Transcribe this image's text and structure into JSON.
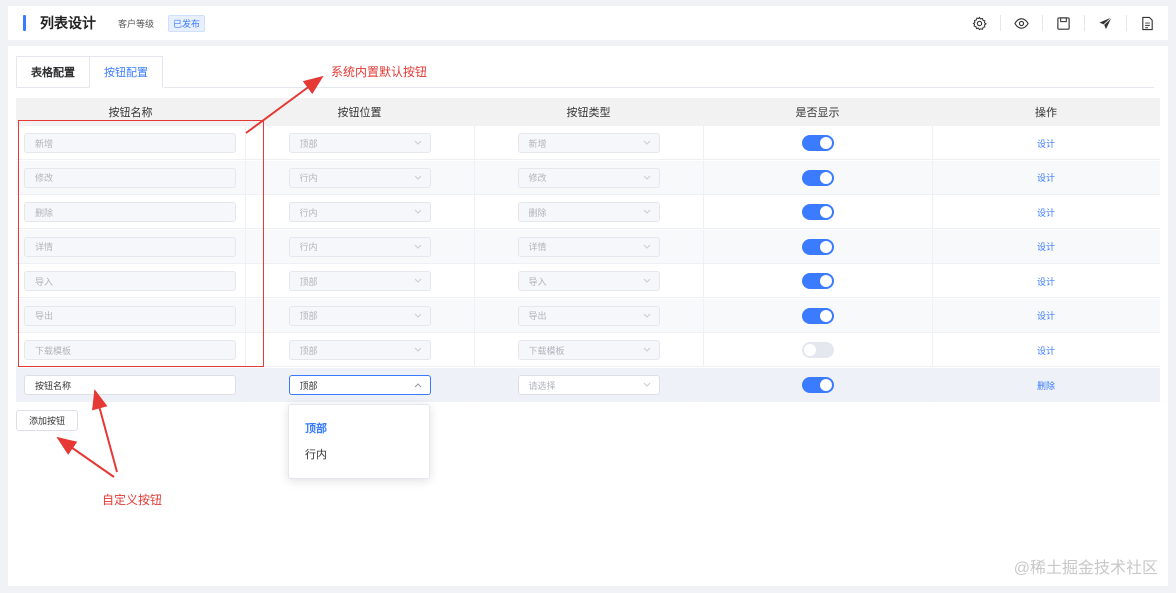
{
  "header": {
    "title": "列表设计",
    "subtitle": "客户等级",
    "status_badge": "已发布",
    "tools": [
      "settings-icon",
      "preview-icon",
      "save-icon",
      "publish-icon",
      "document-icon"
    ]
  },
  "tabs": [
    {
      "label": "表格配置",
      "active": false
    },
    {
      "label": "按钮配置",
      "active": true
    }
  ],
  "table": {
    "columns": [
      "按钮名称",
      "按钮位置",
      "按钮类型",
      "是否显示",
      "操作"
    ],
    "rows": [
      {
        "name": "新增",
        "position": "顶部",
        "type": "新增",
        "show": true,
        "action": "设计"
      },
      {
        "name": "修改",
        "position": "行内",
        "type": "修改",
        "show": true,
        "action": "设计"
      },
      {
        "name": "删除",
        "position": "行内",
        "type": "删除",
        "show": true,
        "action": "设计"
      },
      {
        "name": "详情",
        "position": "行内",
        "type": "详情",
        "show": true,
        "action": "设计"
      },
      {
        "name": "导入",
        "position": "顶部",
        "type": "导入",
        "show": true,
        "action": "设计"
      },
      {
        "name": "导出",
        "position": "顶部",
        "type": "导出",
        "show": true,
        "action": "设计"
      },
      {
        "name": "下载模板",
        "position": "顶部",
        "type": "下载模板",
        "show": false,
        "action": "设计"
      }
    ],
    "custom_row": {
      "name": "按钮名称",
      "position": "顶部",
      "type_placeholder": "请选择",
      "show": true,
      "action": "删除"
    }
  },
  "add_button": "添加按钮",
  "position_dropdown": {
    "options": [
      "顶部",
      "行内"
    ],
    "selected": "顶部"
  },
  "annotations": {
    "default_buttons": "系统内置默认按钮",
    "custom_buttons": "自定义按钮",
    "color": "#e53935"
  },
  "watermark": "@稀土掘金技术社区",
  "colors": {
    "accent": "#3a7bff"
  }
}
